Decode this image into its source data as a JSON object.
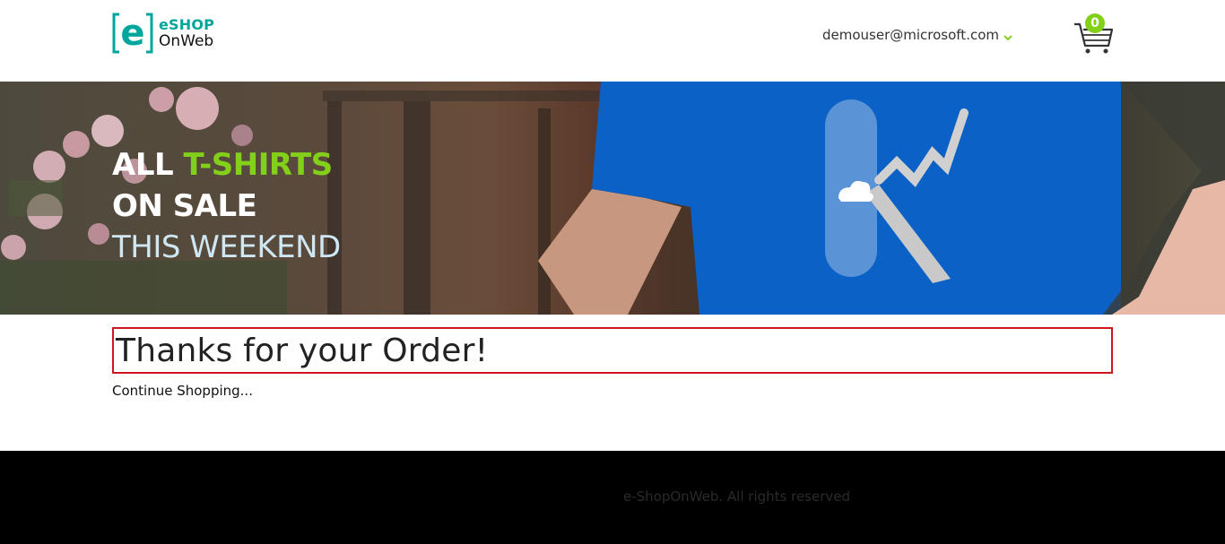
{
  "header": {
    "logo": {
      "line1": "eSHOP",
      "line2": "OnWeb",
      "mark": "e"
    },
    "user_email": "demouser@microsoft.com",
    "cart_count": "0"
  },
  "hero": {
    "line1_part1": "ALL ",
    "line1_part2": "T-SHIRTS",
    "line2": "ON SALE",
    "line3": "THIS WEEKEND"
  },
  "main": {
    "title": "Thanks for your Order!",
    "continue_label": "Continue Shopping..."
  },
  "footer": {
    "copyright": "e-ShopOnWeb. All rights reserved"
  },
  "colors": {
    "brand_teal": "#00a69c",
    "accent_green": "#83d01b",
    "highlight_red": "#d0161d",
    "footer_bg": "#000000"
  },
  "icons": [
    "eshop-logo-icon",
    "chevron-down-icon",
    "shopping-cart-icon"
  ]
}
